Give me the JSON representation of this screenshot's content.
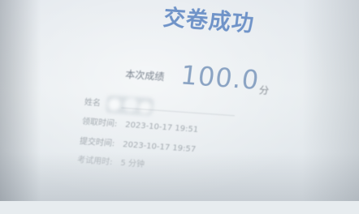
{
  "result_page": {
    "title": "交卷成功",
    "score_label": "本次成绩",
    "score_value": "100.0",
    "score_unit": "分",
    "info": {
      "name_label": "姓名",
      "receive_time_label": "领取时间:",
      "receive_time_value": "2023-10-17 19:51",
      "submit_time_label": "提交时间:",
      "submit_time_value": "2023-10-17 19:57",
      "duration_label": "考试用时:",
      "duration_value": "5 分钟"
    }
  },
  "colors": {
    "title": "#6f93c8",
    "score": "#8aa3c3",
    "background": "#e7ecef"
  }
}
